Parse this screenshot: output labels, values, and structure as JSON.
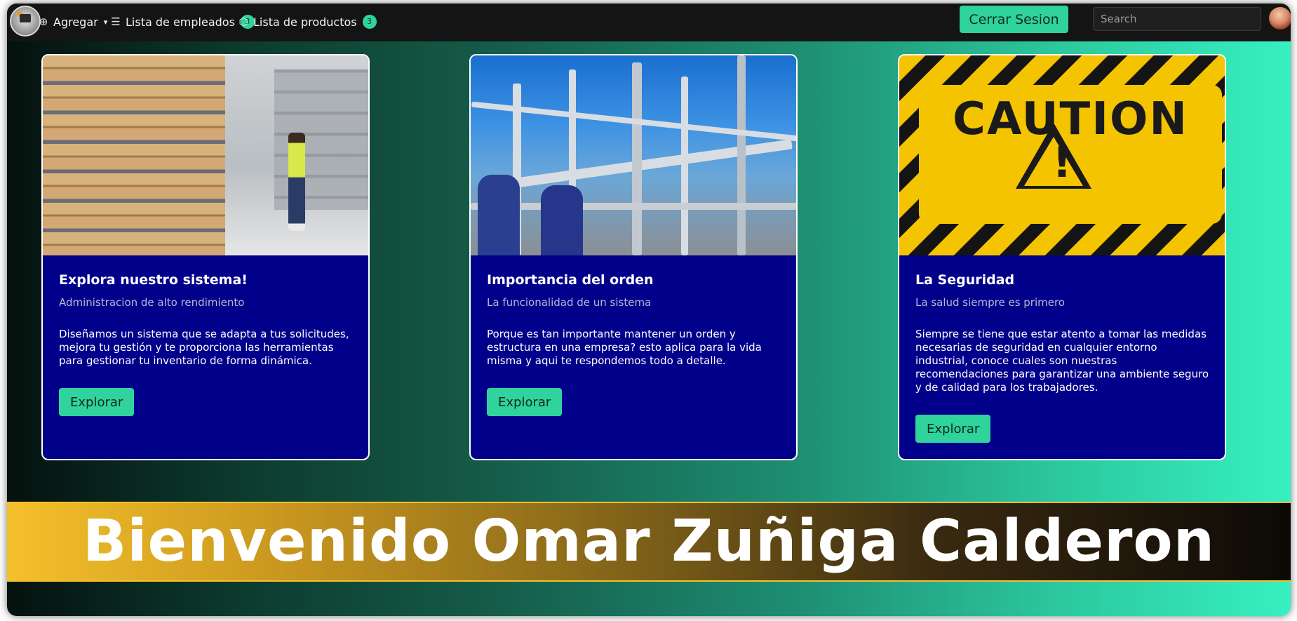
{
  "navbar": {
    "add_label": "Agregar",
    "employees_label": "Lista de empleados",
    "employees_count": "3",
    "products_label": "Lista de productos",
    "products_count": "3",
    "logout_label": "Cerrar Sesion",
    "search_placeholder": "Search",
    "icons": {
      "add": "plus-circle-icon",
      "employees": "database-icon",
      "products": "box-icon",
      "dropdown": "chevron-down-icon"
    }
  },
  "cards": [
    {
      "image": "warehouse-photo",
      "title": "Explora nuestro sistema!",
      "subtitle": "Administracion de alto rendimiento",
      "text": "Diseñamos un sistema que se adapta a tus solicitudes, mejora tu gestión y te proporciona las herramientas para gestionar tu inventario de forma dinámica.",
      "button": "Explorar"
    },
    {
      "image": "industrial-plant-photo",
      "title": "Importancia del orden",
      "subtitle": "La funcionalidad de un sistema",
      "text": "Porque es tan importante mantener un orden y estructura en una empresa? esto aplica para la vida misma y aqui te respondemos todo a detalle.",
      "button": "Explorar"
    },
    {
      "image": "caution-sign",
      "image_text": "CAUTION",
      "title": "La Seguridad",
      "subtitle": "La salud siempre es primero",
      "text": "Siempre se tiene que estar atento a tomar las medidas necesarias de seguridad en cualquier entorno industrial, conoce cuales son nuestras recomendaciones para garantizar una ambiente seguro y de calidad para los trabajadores.",
      "button": "Explorar"
    }
  ],
  "welcome": "Bienvenido Omar Zuñiga Calderon",
  "colors": {
    "accent": "#2fd39b",
    "card_bg": "#00008b",
    "navbar_bg": "#141414",
    "banner_gold": "#f5c02a"
  }
}
